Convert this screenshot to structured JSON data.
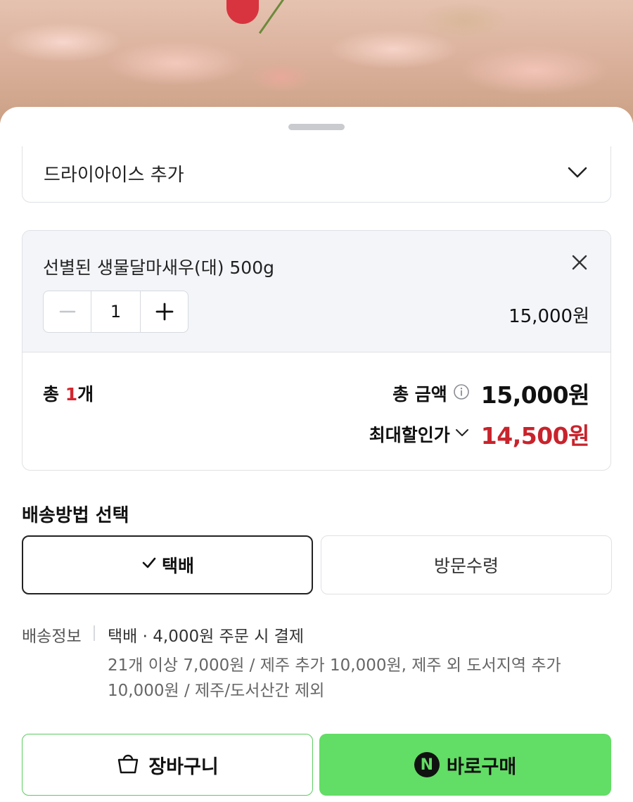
{
  "option_select": {
    "label": "드라이아이스 추가"
  },
  "selected_item": {
    "name": "선별된 생물달마새우(대) 500g",
    "quantity": "1",
    "price": "15,000원"
  },
  "summary": {
    "count_prefix": "총 ",
    "count_value": "1",
    "count_suffix": "개",
    "total_label": "총 금액",
    "total_amount": "15,000원",
    "discount_label": "최대할인가",
    "discount_amount": "14,500원"
  },
  "shipping": {
    "title": "배송방법 선택",
    "options": [
      "택배",
      "방문수령"
    ],
    "selected": "택배",
    "info_label": "배송정보",
    "info_main": "택배 · 4,000원 주문 시 결제",
    "info_sub": "21개 이상 7,000원 / 제주 추가 10,000원, 제주 외 도서지역 추가 10,000원 / 제주/도서산간 제외"
  },
  "actions": {
    "cart_label": "장바구니",
    "buy_label": "바로구매",
    "buy_logo": "N"
  },
  "colors": {
    "accent_green": "#62dd65",
    "price_red": "#c8232c",
    "count_red": "#d3262e"
  },
  "icons": [
    "chevron-down-icon",
    "close-icon",
    "minus-icon",
    "plus-icon",
    "info-icon",
    "check-icon",
    "shopping-bag-icon",
    "naver-n-logo"
  ]
}
